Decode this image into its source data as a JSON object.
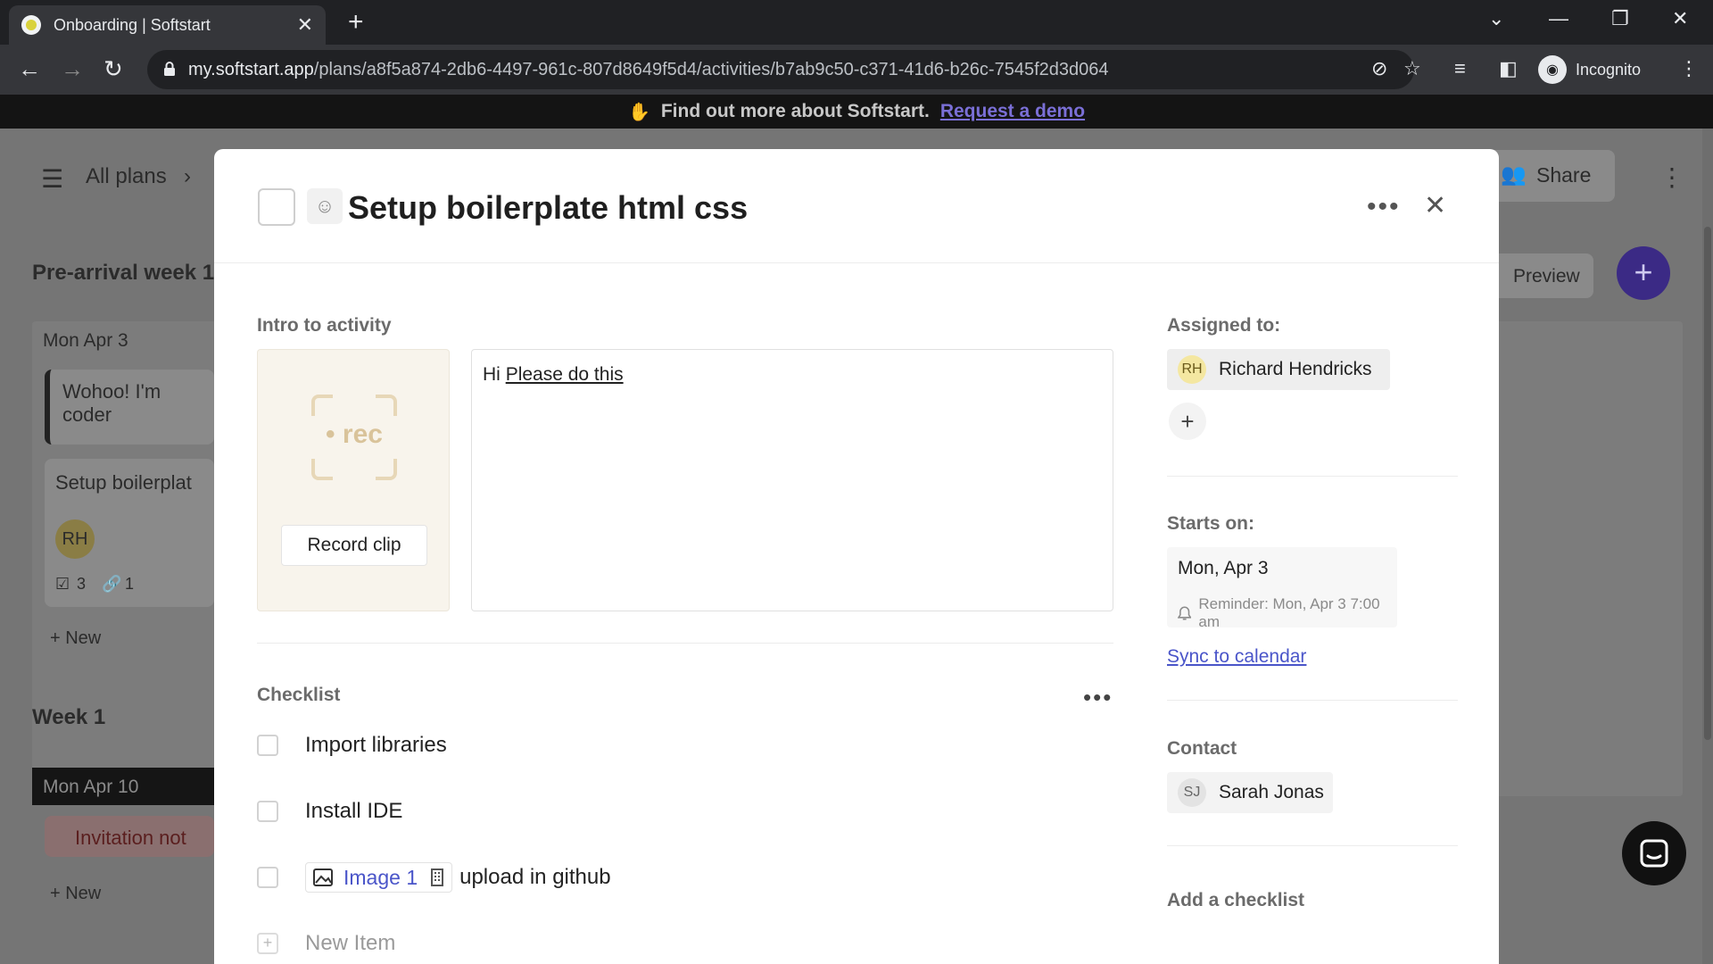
{
  "browser": {
    "tab_title": "Onboarding | Softstart",
    "url_host": "my.softstart.app",
    "url_path": "/plans/a8f5a874-2db6-4497-961c-807d8649f5d4/activities/b7ab9c50-c371-41d6-b26c-7545f2d3d064",
    "incognito_label": "Incognito"
  },
  "banner": {
    "text": "Find out more about Softstart.",
    "link": "Request a demo"
  },
  "background": {
    "breadcrumb": "All plans",
    "share_label": "Share",
    "preview_label": "Preview",
    "section1_title": "Pre-arrival week 1",
    "day1_label": "Mon   Apr 3",
    "card1_text": "Wohoo! I'm coder",
    "card2_text": "Setup boilerplat",
    "card2_avatar": "RH",
    "card2_checks": "3",
    "card2_links": "1",
    "new_label": "+ New",
    "section2_title": "Week 1",
    "day2_label": "Mon   Apr 10",
    "invitation_text": "Invitation not"
  },
  "modal": {
    "title": "Setup boilerplate html css",
    "intro_label": "Intro to activity",
    "rec_label": "rec",
    "record_clip": "Record clip",
    "editor_prefix": "Hi",
    "editor_link": "Please do this",
    "checklist_label": "Checklist",
    "checklist_items": [
      {
        "label": "Import libraries"
      },
      {
        "label": "Install IDE"
      },
      {
        "image_label": "Image 1",
        "label": "upload in github"
      }
    ],
    "new_item": "New Item",
    "assigned_label": "Assigned to:",
    "assignee": {
      "initials": "RH",
      "name": "Richard Hendricks"
    },
    "starts_label": "Starts on:",
    "start_date": "Mon, Apr 3",
    "reminder": "Reminder: Mon, Apr 3 7:00 am",
    "sync_label": "Sync to calendar",
    "contact_label": "Contact",
    "contact": {
      "initials": "SJ",
      "name": "Sarah Jonas"
    },
    "add_checklist": "Add a checklist"
  },
  "colors": {
    "accent": "#4a55c9",
    "brand_purple": "#5b3fbf",
    "avatar_yellow": "#f4e7a1"
  }
}
